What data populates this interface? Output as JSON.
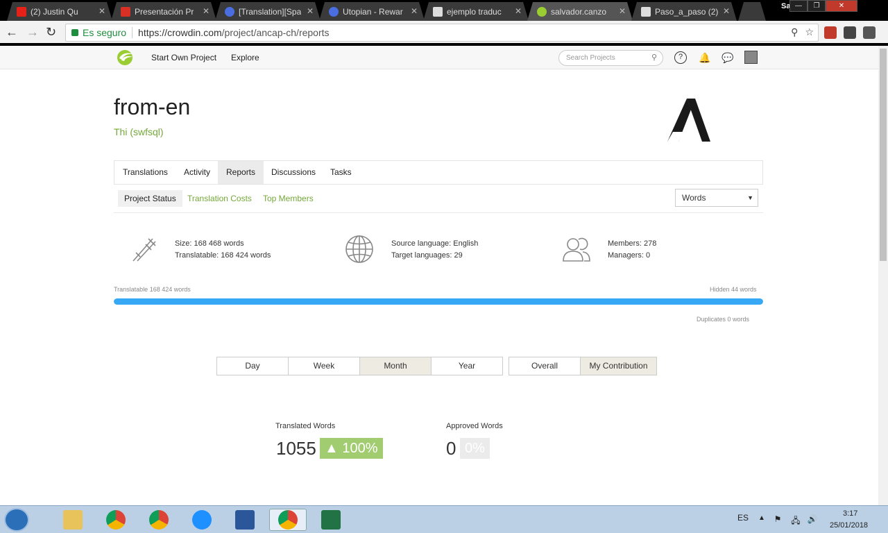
{
  "browser": {
    "tabs": [
      {
        "title": "(2) Justin Qu",
        "favicon_color": "#e62117"
      },
      {
        "title": "Presentación Pr",
        "favicon_color": "#d93025"
      },
      {
        "title": "[Translation][Spa",
        "favicon_color": "#4a6ee0"
      },
      {
        "title": "Utopian - Rewar",
        "favicon_color": "#4a6ee0"
      },
      {
        "title": "ejemplo traduc",
        "favicon_color": "#dddddd"
      },
      {
        "title": "salvador.canzo",
        "favicon_color": "#9acd32"
      },
      {
        "title": "Paso_a_paso (2)",
        "favicon_color": "#dddddd"
      }
    ],
    "user_name": "Salvador",
    "secure_label": "Es seguro",
    "url_host": "https://crowdin.com",
    "url_path": "/project/ancap-ch/reports"
  },
  "site_header": {
    "nav": [
      "Start Own Project",
      "Explore"
    ],
    "search_placeholder": "Search Projects"
  },
  "project": {
    "title": "from-en",
    "owner": "Thi (swfsql)"
  },
  "tabs": [
    "Translations",
    "Activity",
    "Reports",
    "Discussions",
    "Tasks"
  ],
  "active_tab": "Reports",
  "subtabs": [
    "Project Status",
    "Translation Costs",
    "Top Members"
  ],
  "unit_select": "Words",
  "stats": {
    "size": "Size: 168 468 words",
    "translatable": "Translatable: 168 424 words",
    "source_language": "Source language: English",
    "target_languages": "Target languages: 29",
    "members": "Members: 278",
    "managers": "Managers: 0"
  },
  "progress": {
    "left_label": "Translatable 168 424 words",
    "right_label": "Hidden 44 words",
    "duplicates_label": "Duplicates 0 words",
    "fill_fraction": 0.9997
  },
  "period_buttons": [
    "Day",
    "Week",
    "Month",
    "Year"
  ],
  "active_period": "Month",
  "scope_buttons": [
    "Overall",
    "My Contribution"
  ],
  "active_scope": "My Contribution",
  "metrics": {
    "translated_label": "Translated Words",
    "translated_value": "1055",
    "translated_badge": "▲ 100%",
    "approved_label": "Approved Words",
    "approved_value": "0",
    "approved_badge": "0%"
  },
  "taskbar": {
    "lang": "ES",
    "time": "3:17",
    "date": "25/01/2018"
  },
  "colors": {
    "accent_green": "#74a839",
    "progress_blue": "#36a8f5",
    "badge_green": "#a1cc6f"
  }
}
